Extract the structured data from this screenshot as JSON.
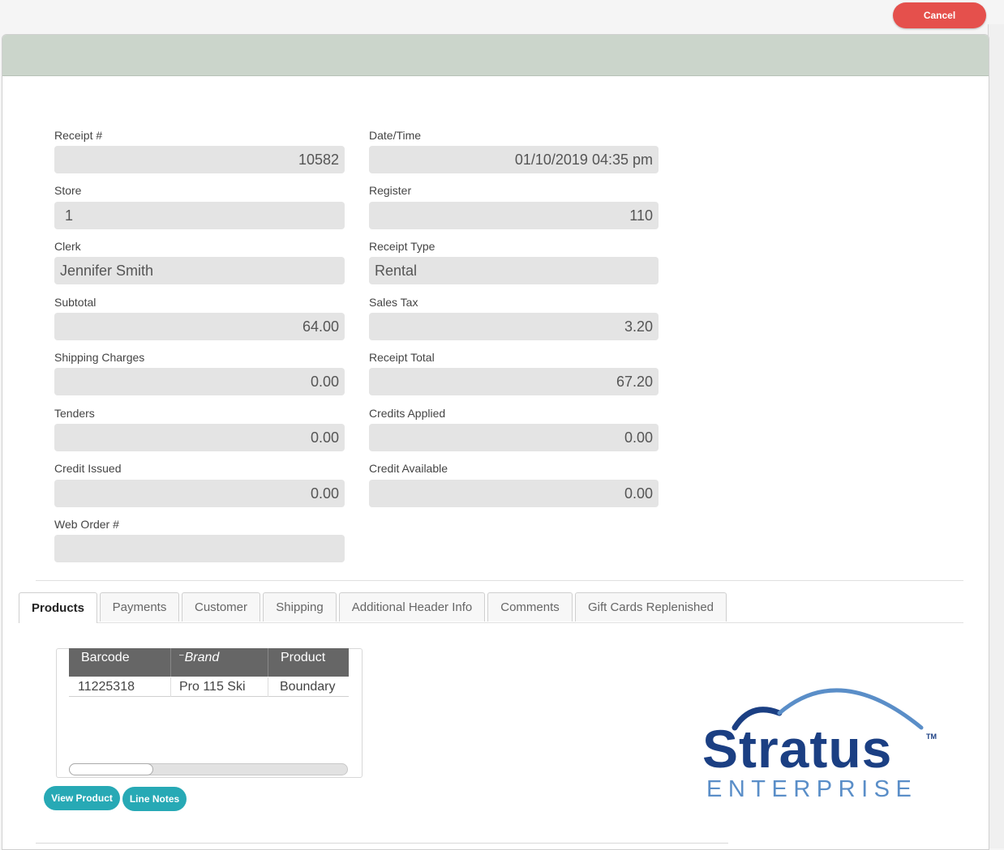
{
  "toolbar": {
    "cancel_label": "Cancel"
  },
  "form": {
    "receipt_no": {
      "label": "Receipt #",
      "value": "10582"
    },
    "date_time": {
      "label": "Date/Time",
      "value": "01/10/2019 04:35 pm"
    },
    "store": {
      "label": "Store",
      "value": "1"
    },
    "register": {
      "label": "Register",
      "value": "110"
    },
    "clerk": {
      "label": "Clerk",
      "value": "Jennifer Smith"
    },
    "receipt_type": {
      "label": "Receipt Type",
      "value": "Rental"
    },
    "subtotal": {
      "label": "Subtotal",
      "value": "64.00"
    },
    "sales_tax": {
      "label": "Sales Tax",
      "value": "3.20"
    },
    "shipping_charges": {
      "label": "Shipping Charges",
      "value": "0.00"
    },
    "receipt_total": {
      "label": "Receipt Total",
      "value": "67.20"
    },
    "tenders": {
      "label": "Tenders",
      "value": "0.00"
    },
    "credits_applied": {
      "label": "Credits Applied",
      "value": "0.00"
    },
    "credit_issued": {
      "label": "Credit Issued",
      "value": "0.00"
    },
    "credit_available": {
      "label": "Credit Available",
      "value": "0.00"
    },
    "web_order_no": {
      "label": "Web Order #",
      "value": ""
    }
  },
  "tabs": [
    {
      "label": "Products",
      "active": true
    },
    {
      "label": "Payments"
    },
    {
      "label": "Customer"
    },
    {
      "label": "Shipping"
    },
    {
      "label": "Additional Header Info"
    },
    {
      "label": "Comments"
    },
    {
      "label": "Gift Cards Replenished"
    }
  ],
  "products_table": {
    "columns": [
      "Barcode",
      "Brand",
      "Product"
    ],
    "rows": [
      [
        "11225318",
        "Pro 115 Ski",
        "Boundary"
      ]
    ]
  },
  "actions": {
    "view_product_label": "View Product",
    "line_notes_label": "Line Notes"
  },
  "logo": {
    "word": "Stratus",
    "sub": "ENTERPRISE",
    "tm": "TM"
  },
  "colors": {
    "cancel": "#e5504c",
    "action": "#27a9b5",
    "header": "#cbd5cb",
    "logo_dark": "#1b3f83",
    "logo_light": "#5a8ec8"
  }
}
